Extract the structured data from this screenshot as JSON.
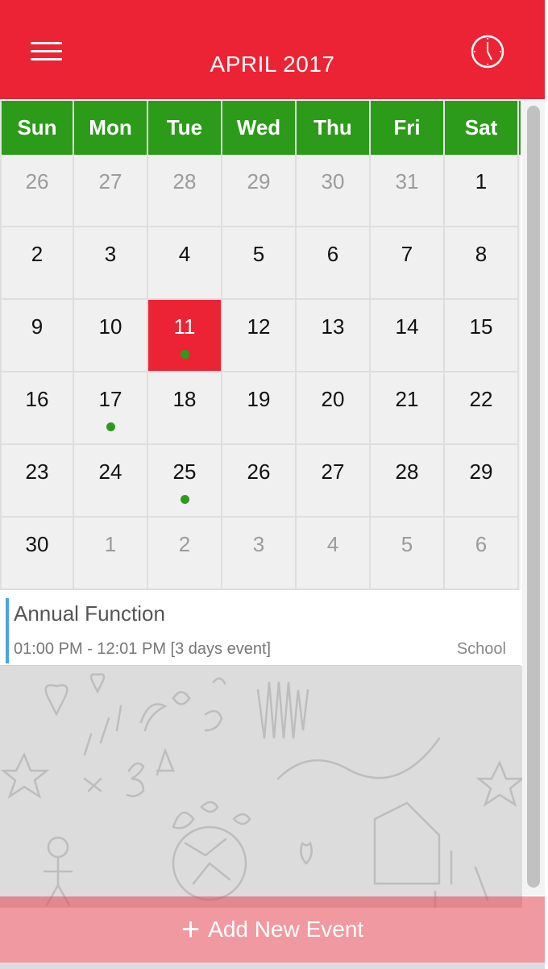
{
  "header": {
    "title": "APRIL 2017",
    "menu_icon": "hamburger-menu-icon",
    "clock_icon": "clock-icon",
    "color": "#ec2334"
  },
  "calendar": {
    "weekdays": [
      "Sun",
      "Mon",
      "Tue",
      "Wed",
      "Thu",
      "Fri",
      "Sat"
    ],
    "header_color": "#2c9b1a",
    "weeks": [
      [
        {
          "d": "26",
          "o": true
        },
        {
          "d": "27",
          "o": true
        },
        {
          "d": "28",
          "o": true
        },
        {
          "d": "29",
          "o": true
        },
        {
          "d": "30",
          "o": true
        },
        {
          "d": "31",
          "o": true
        },
        {
          "d": "1"
        }
      ],
      [
        {
          "d": "2"
        },
        {
          "d": "3"
        },
        {
          "d": "4"
        },
        {
          "d": "5"
        },
        {
          "d": "6"
        },
        {
          "d": "7"
        },
        {
          "d": "8"
        }
      ],
      [
        {
          "d": "9"
        },
        {
          "d": "10"
        },
        {
          "d": "11",
          "today": true,
          "event": true
        },
        {
          "d": "12"
        },
        {
          "d": "13"
        },
        {
          "d": "14"
        },
        {
          "d": "15"
        }
      ],
      [
        {
          "d": "16"
        },
        {
          "d": "17",
          "event": true
        },
        {
          "d": "18"
        },
        {
          "d": "19"
        },
        {
          "d": "20"
        },
        {
          "d": "21"
        },
        {
          "d": "22"
        }
      ],
      [
        {
          "d": "23"
        },
        {
          "d": "24"
        },
        {
          "d": "25",
          "event": true
        },
        {
          "d": "26"
        },
        {
          "d": "27"
        },
        {
          "d": "28"
        },
        {
          "d": "29"
        }
      ],
      [
        {
          "d": "30"
        },
        {
          "d": "1",
          "o": true
        },
        {
          "d": "2",
          "o": true
        },
        {
          "d": "3",
          "o": true
        },
        {
          "d": "4",
          "o": true
        },
        {
          "d": "5",
          "o": true
        },
        {
          "d": "6",
          "o": true
        }
      ]
    ]
  },
  "event": {
    "title": "Annual Function",
    "time": "01:00 PM - 12:01 PM [3 days event]",
    "category": "School",
    "accent": "#4aa3e6"
  },
  "footer": {
    "add_label": "Add New Event",
    "plus_icon": "plus-icon"
  }
}
